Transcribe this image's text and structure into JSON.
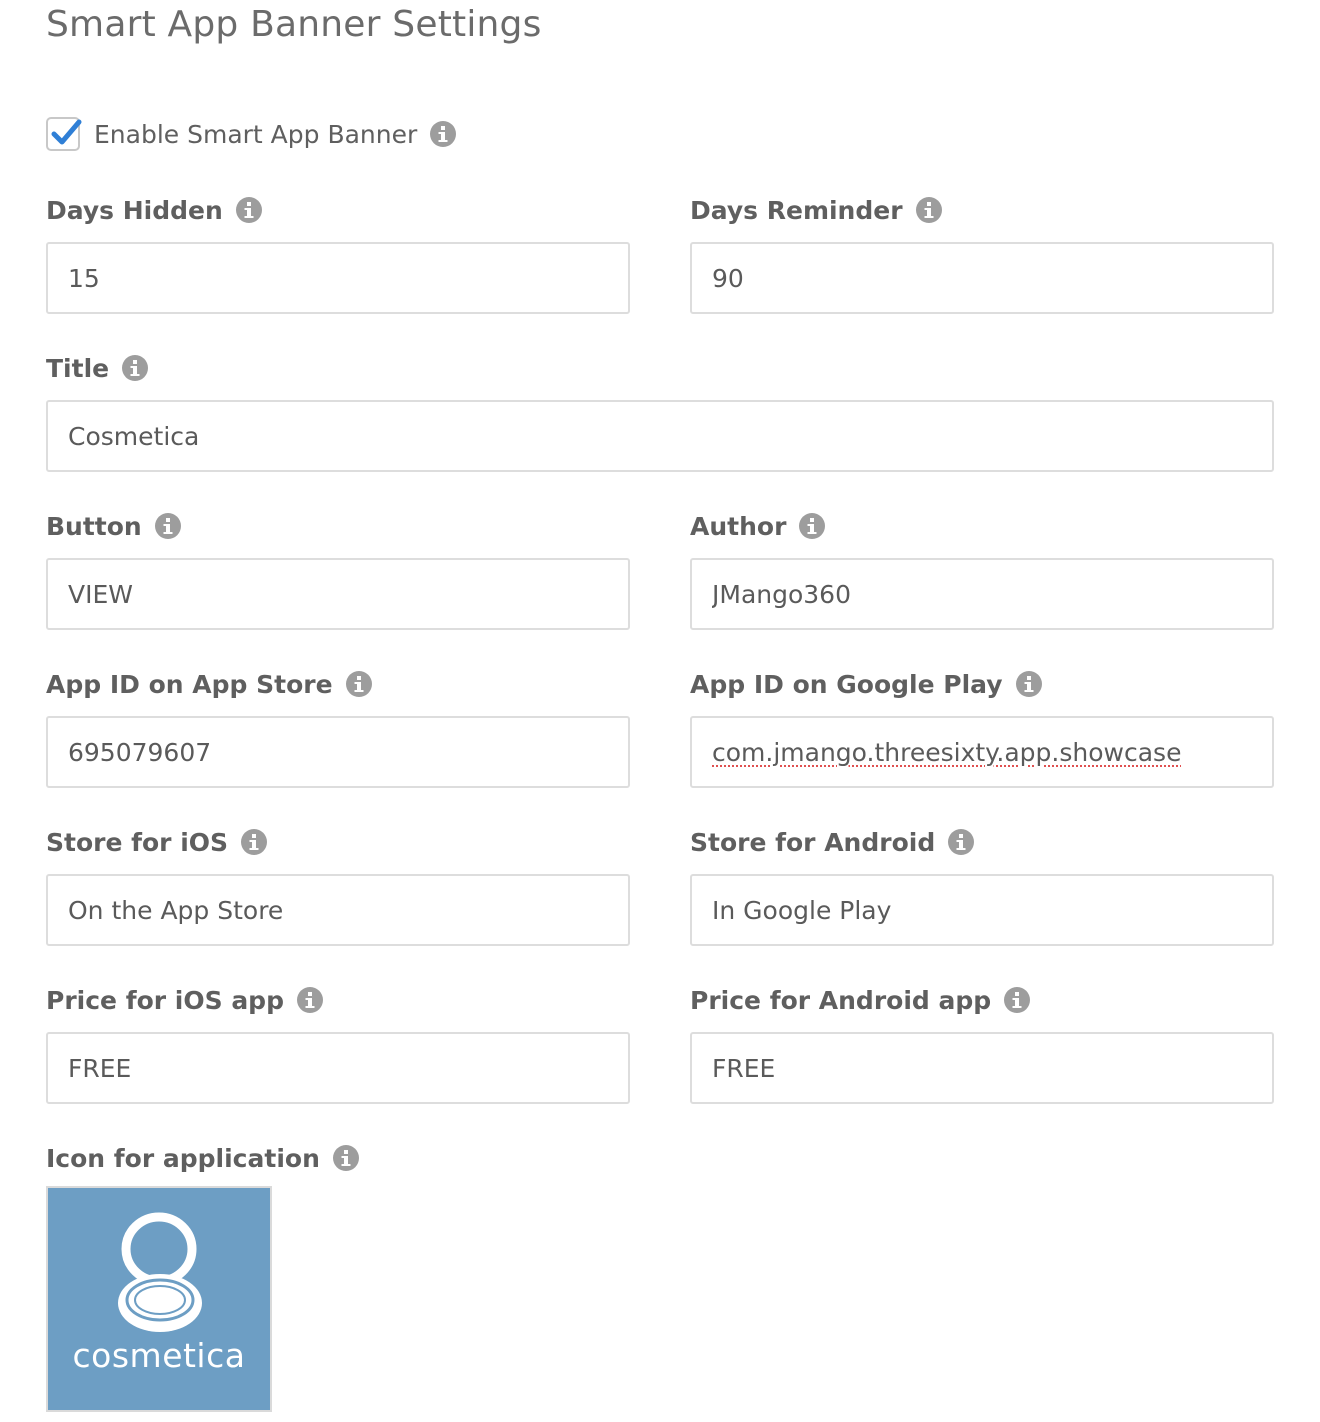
{
  "page": {
    "title": "Smart App Banner Settings"
  },
  "enable": {
    "label": "Enable Smart App Banner",
    "checked": true,
    "check_color": "#2f7fd6"
  },
  "fields": {
    "days_hidden": {
      "label": "Days Hidden",
      "value": "15"
    },
    "days_reminder": {
      "label": "Days Reminder",
      "value": "90"
    },
    "title": {
      "label": "Title",
      "value": "Cosmetica"
    },
    "button": {
      "label": "Button",
      "value": "VIEW"
    },
    "author": {
      "label": "Author",
      "value": "JMango360"
    },
    "app_id_app_store": {
      "label": "App ID on App Store",
      "value": "695079607"
    },
    "app_id_google_play": {
      "label": "App ID on Google Play",
      "value": "com.jmango.threesixty.app.showcase"
    },
    "store_ios": {
      "label": "Store for iOS",
      "value": "On the App Store"
    },
    "store_android": {
      "label": "Store for Android",
      "value": "In Google Play"
    },
    "price_ios": {
      "label": "Price for iOS app",
      "value": "FREE"
    },
    "price_android": {
      "label": "Price for Android app",
      "value": "FREE"
    }
  },
  "app_icon": {
    "label": "Icon for application",
    "brand_text": "cosmetica",
    "background_color": "#6d9ec4"
  },
  "icons": {
    "info": "info-icon",
    "check": "check-icon",
    "mirror": "compact-mirror-icon"
  }
}
